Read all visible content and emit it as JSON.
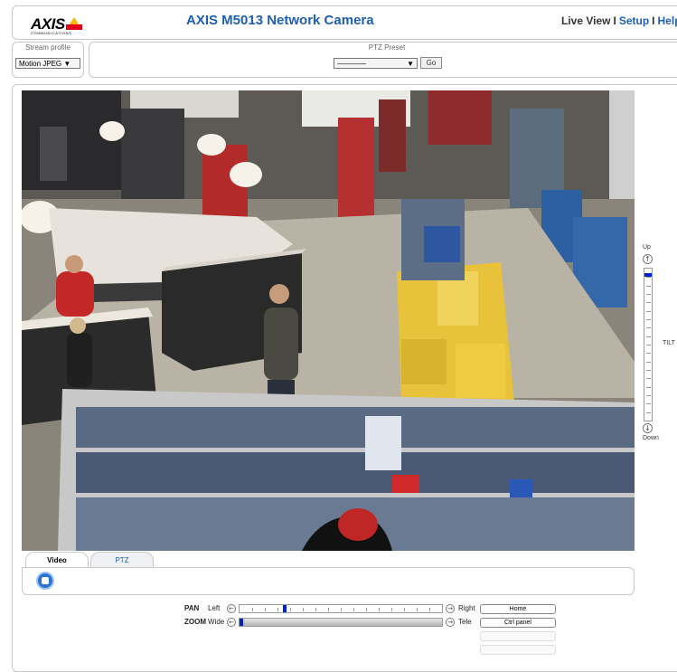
{
  "header": {
    "logo_text": "AXIS",
    "logo_sub": "COMMUNICATIONS",
    "title": "AXIS M5013 Network Camera",
    "nav": {
      "live_view": "Live View",
      "separator": "I",
      "setup": "Setup",
      "help": "Help"
    }
  },
  "stream_profile": {
    "label": "Stream profile",
    "value": "Motion JPEG"
  },
  "ptz_preset": {
    "label": "PTZ Preset",
    "value": "————",
    "go_label": "Go"
  },
  "video": {
    "content": "live-camera-feed"
  },
  "tilt": {
    "up_label": "Up",
    "down_label": "Down",
    "label": "TILT",
    "up_icon": "arrow-up-icon",
    "down_icon": "arrow-down-icon",
    "position": 0.03
  },
  "tabs": [
    {
      "label": "Video",
      "active": true
    },
    {
      "label": "PTZ",
      "active": false
    }
  ],
  "pan": {
    "label": "PAN",
    "left_label": "Left",
    "right_label": "Right",
    "position": 0.22
  },
  "zoom": {
    "label": "ZOOM",
    "wide_label": "Wide",
    "tele_label": "Tele",
    "position": 0.0
  },
  "right_buttons": {
    "home": "Home",
    "ctrl_panel": "Ctrl panel"
  },
  "colors": {
    "accent": "#1f5fae",
    "slider_thumb": "#0022cc",
    "stop_button": "#2a72d4"
  }
}
